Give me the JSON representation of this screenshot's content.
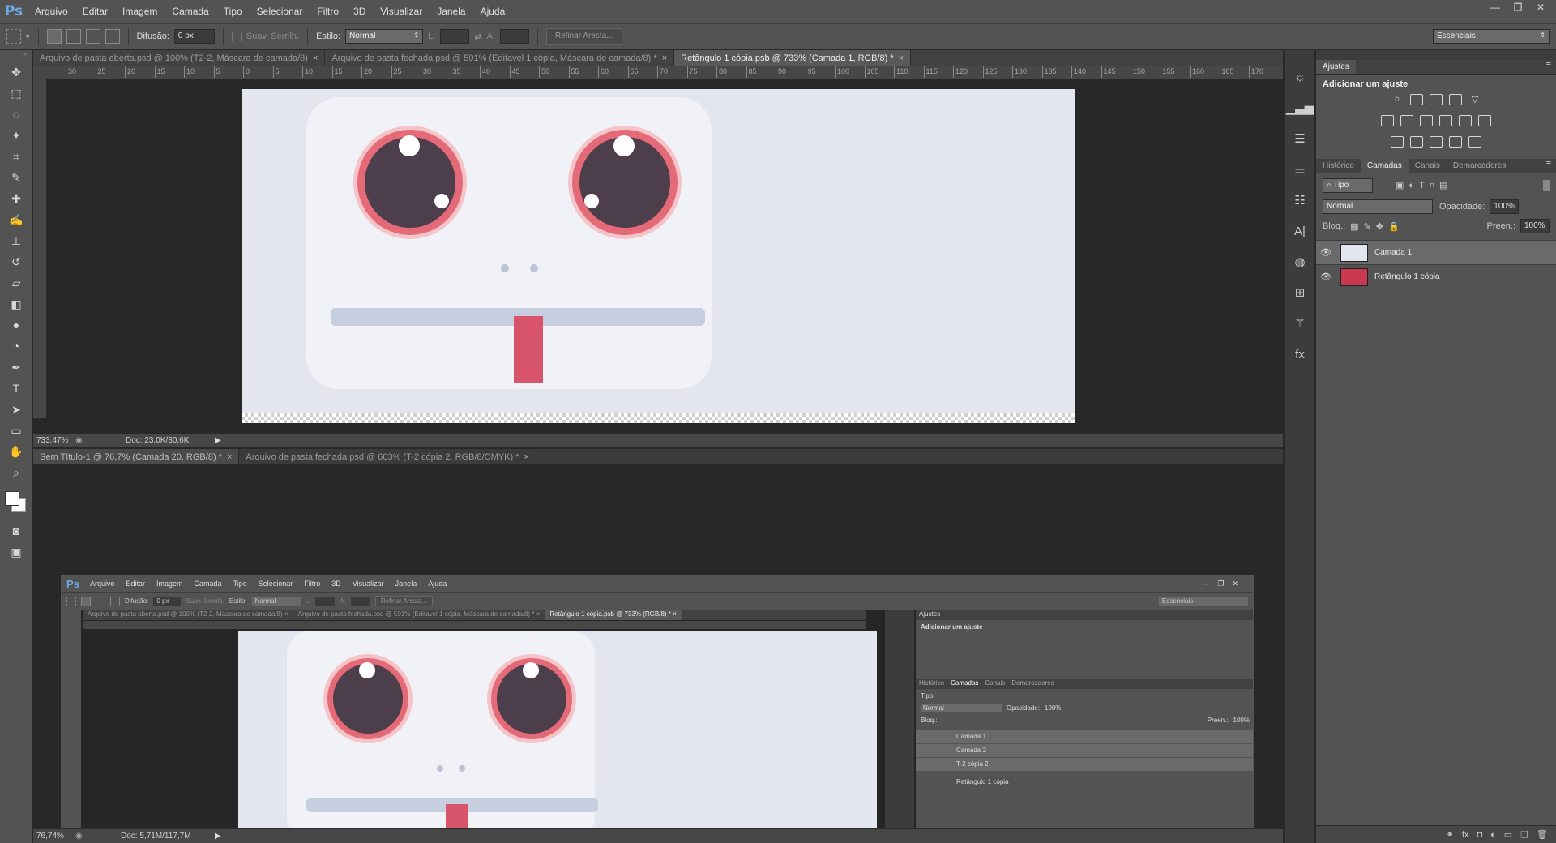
{
  "app": {
    "logo": "Ps"
  },
  "menu": [
    "Arquivo",
    "Editar",
    "Imagem",
    "Camada",
    "Tipo",
    "Selecionar",
    "Filtro",
    "3D",
    "Visualizar",
    "Janela",
    "Ajuda"
  ],
  "options": {
    "feather_label": "Difusão:",
    "feather_value": "0 px",
    "antialias_label": "Suav. Serrilh.",
    "style_label": "Estilo:",
    "style_value": "Normal",
    "width_label": "L:",
    "height_label": "A:",
    "refine_button": "Refinar Aresta...",
    "workspace": "Essenciais"
  },
  "top_group": {
    "tabs": [
      {
        "label": "Arquivo de pasta aberta.psd @ 100% (T2-2, Máscara de camada/8)",
        "close": "×",
        "active": false
      },
      {
        "label": "Arquivo de pasta fechada.psd @ 591% (Editavel 1 cópia, Máscara de camada/8) *",
        "close": "×",
        "active": false
      },
      {
        "label": "Retângulo 1 cópia.psb @ 733% (Camada 1, RGB/8) *",
        "close": "×",
        "active": true
      }
    ],
    "ruler": [
      "30",
      "25",
      "20",
      "15",
      "10",
      "5",
      "0",
      "5",
      "10",
      "15",
      "20",
      "25",
      "30",
      "35",
      "40",
      "45",
      "50",
      "55",
      "60",
      "65",
      "70",
      "75",
      "80",
      "85",
      "90",
      "95",
      "100",
      "105",
      "110",
      "115",
      "120",
      "125",
      "130",
      "135",
      "140",
      "145",
      "150",
      "155",
      "160",
      "165",
      "170"
    ],
    "zoom": "733,47%",
    "doc": "Doc: 23,0K/30,6K"
  },
  "bottom_group": {
    "tabs": [
      {
        "label": "Sem Título-1 @ 76,7% (Camada 20, RGB/8) *",
        "close": "×",
        "active": true
      },
      {
        "label": "Arquivo de pasta fechada.psd @ 603% (T-2 cópia 2, RGB/8/CMYK) *",
        "close": "×",
        "active": false
      }
    ],
    "zoom": "76,74%",
    "doc": "Doc: 5,71M/117,7M"
  },
  "nested": {
    "logo": "Ps",
    "menu": [
      "Arquivo",
      "Editar",
      "Imagem",
      "Camada",
      "Tipo",
      "Selecionar",
      "Filtro",
      "3D",
      "Visualizar",
      "Janela",
      "Ajuda"
    ],
    "feather_label": "Difusão:",
    "feather_value": "0 px",
    "antialias_label": "Suav. Serrilh.",
    "style_label": "Estilo:",
    "style_value": "Normal",
    "width_label": "L:",
    "height_label": "A:",
    "refine_button": "Refinar Aresta...",
    "workspace": "Essenciais",
    "tabs": [
      {
        "label": "Arquivo de pasta aberta.psd @ 100% (T2-2, Máscara de camada/8)",
        "close": "×"
      },
      {
        "label": "Arquivo de pasta fechada.psd @ 591% (Editavel 1 cópia, Máscara de camada/8) *",
        "close": "×"
      },
      {
        "label": "Retângulo 1 cópia.psb @ 733% (RGB/8) *",
        "close": "×"
      }
    ],
    "panel_tab": "Ajustes",
    "adjust_title": "Adicionar um ajuste",
    "layer_tabs": [
      "Histórico",
      "Camadas",
      "Canais",
      "Demarcadores"
    ],
    "filter": "Tipo",
    "blend": "Normal",
    "opacity_label": "Opacidade:",
    "opacity_value": "100%",
    "lock_label": "Bloq.:",
    "fill_label": "Preen.:",
    "fill_value": "100%",
    "layers": [
      "Camada 1",
      "Camada 2",
      "T-2 cópia 2",
      "Retângulo 1 cópia"
    ]
  },
  "panels": {
    "adjust_tab": "Ajustes",
    "adjust_title": "Adicionar um ajuste",
    "layer_tabs": [
      "Histórico",
      "Camadas",
      "Canais",
      "Demarcadores"
    ],
    "filter": "Tipo",
    "blend": "Normal",
    "opacity_label": "Opacidade:",
    "opacity_value": "100%",
    "lock_label": "Bloq.:",
    "fill_label": "Preen.:",
    "fill_value": "100%",
    "layers": [
      {
        "name": "Camada 1",
        "selected": true
      },
      {
        "name": "Retângulo 1 cópia",
        "selected": false
      }
    ]
  },
  "icons": {
    "tools": [
      "move-icon",
      "marquee-icon",
      "lasso-icon",
      "magic-wand-icon",
      "crop-icon",
      "eyedropper-icon",
      "healing-brush-icon",
      "brush-icon",
      "clone-stamp-icon",
      "history-brush-icon",
      "eraser-icon",
      "paint-bucket-icon",
      "blur-icon",
      "dodge-icon",
      "pen-icon",
      "type-icon",
      "path-select-icon",
      "rectangle-icon",
      "hand-icon",
      "zoom-icon"
    ],
    "strip": [
      "sun-icon",
      "histogram-icon",
      "sliders-icon",
      "properties-icon",
      "paragraph-icon",
      "character-icon",
      "3d-icon",
      "grid-icon",
      "brush-preset-icon",
      "style-icon"
    ]
  },
  "colors": {
    "accent": "#6fa8e2",
    "eye_ring": "#e46a78",
    "tongue": "#d8546a",
    "pupil": "#4d3e4c"
  }
}
